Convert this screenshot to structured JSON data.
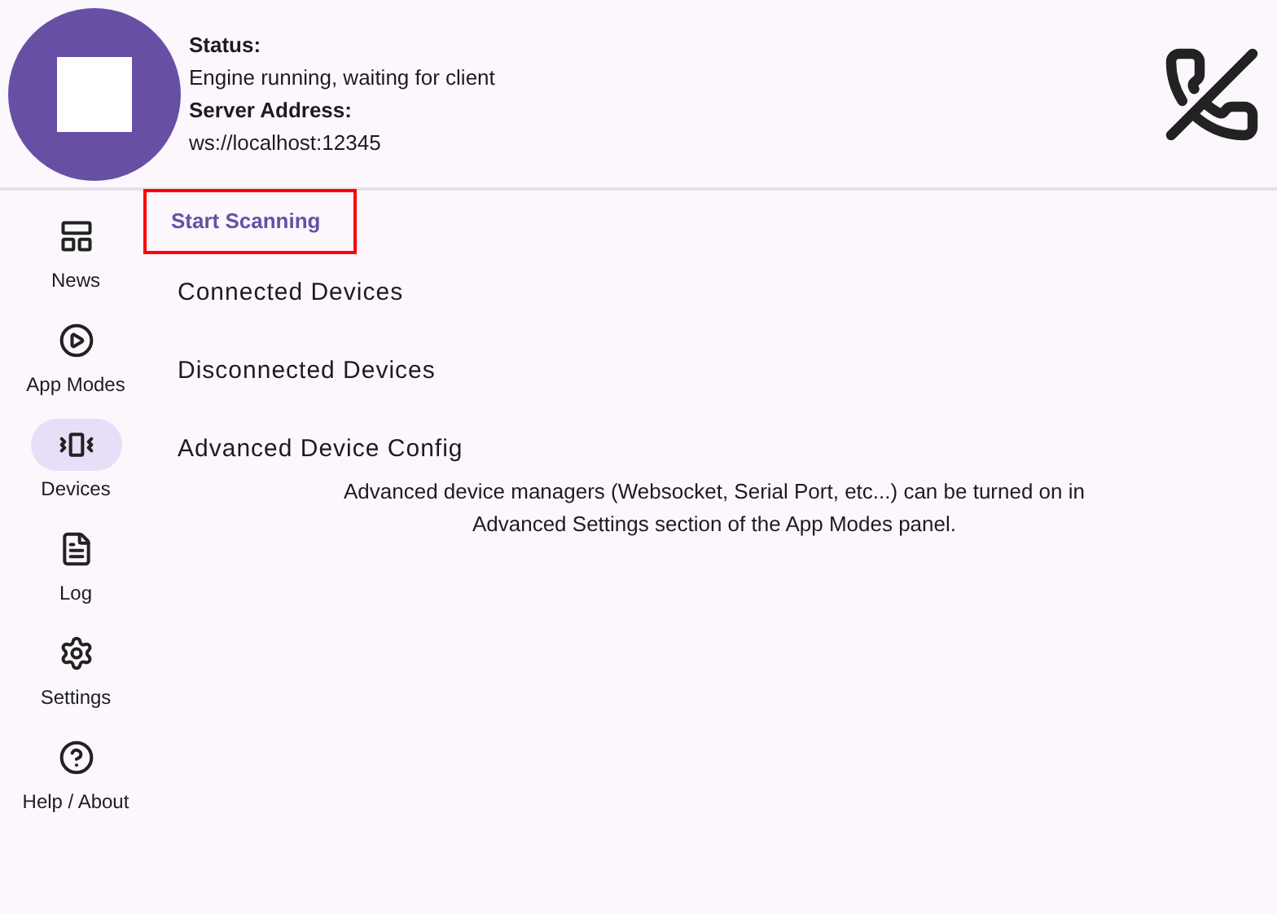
{
  "header": {
    "status_label": "Status:",
    "status": "Engine running, waiting for client",
    "address_label": "Server Address:",
    "address": "ws://localhost:12345"
  },
  "nav": [
    {
      "label": "News",
      "kind": "news",
      "selected": false
    },
    {
      "label": "App Modes",
      "kind": "modes",
      "selected": false
    },
    {
      "label": "Devices",
      "kind": "devices",
      "selected": true
    },
    {
      "label": "Log",
      "kind": "log",
      "selected": false
    },
    {
      "label": "Settings",
      "kind": "settings",
      "selected": false
    },
    {
      "label": "Help / About",
      "kind": "help",
      "selected": false
    }
  ],
  "scan_button": {
    "label": "Start Scanning",
    "outlined": true
  },
  "sections": [
    "Connected Devices",
    "Disconnected Devices",
    "Advanced Device Config"
  ],
  "note": "Advanced device managers (Websocket, Serial Port, etc...) can be turned on in Advanced Settings section of the App Modes panel."
}
